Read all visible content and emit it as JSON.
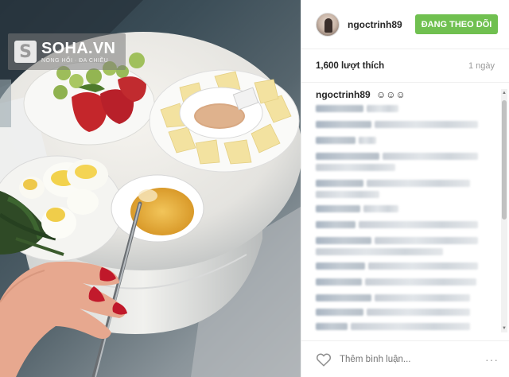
{
  "watermark": {
    "badge": "S",
    "brand": "SOHA.VN",
    "tagline": "NÓNG HỔI · ĐA CHIỀU"
  },
  "post": {
    "username": "ngoctrinh89",
    "follow_label": "ĐANG THEO DÕI",
    "likes": "1,600 lượt thích",
    "time": "1 ngày",
    "caption_user": "ngoctrinh89",
    "caption_text": "☺☺☺",
    "comment_placeholder": "Thêm bình luận...",
    "more_label": "···"
  },
  "colors": {
    "follow_button": "#70c050",
    "text": "#262626",
    "muted": "#999999"
  },
  "icons": {
    "heart": "heart-icon",
    "more": "more-options-icon",
    "badge": "soha-logo-icon"
  }
}
